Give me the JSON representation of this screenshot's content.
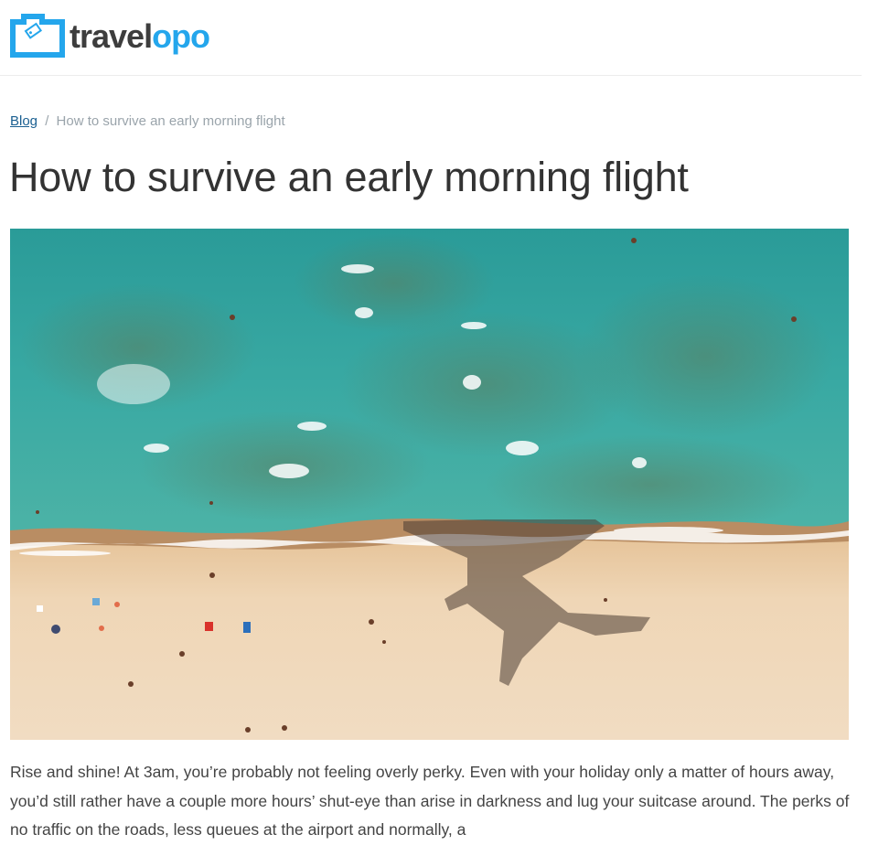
{
  "brand": {
    "name_part1": "travel",
    "name_part2": "opo",
    "primary_color": "#24a6ec",
    "text_color": "#3d3d3d"
  },
  "breadcrumb": {
    "root_label": "Blog",
    "separator": "/",
    "current_label": "How to survive an early morning flight"
  },
  "article": {
    "title": "How to survive an early morning flight",
    "hero_image_alt": "airplane-shadow-over-beach",
    "intro": "Rise and shine! At 3am, you’re probably not feeling overly perky. Even with your holiday only a matter of hours away, you’d still rather have a couple more hours’ shut-eye than arise in darkness and lug your suitcase around. The perks of no traffic on the roads, less queues at the airport and normally, a"
  },
  "colors": {
    "link": "#1a5f91",
    "muted": "#9aa4ab",
    "sea": "#2f9d9a",
    "sand": "#ecd2b0"
  }
}
